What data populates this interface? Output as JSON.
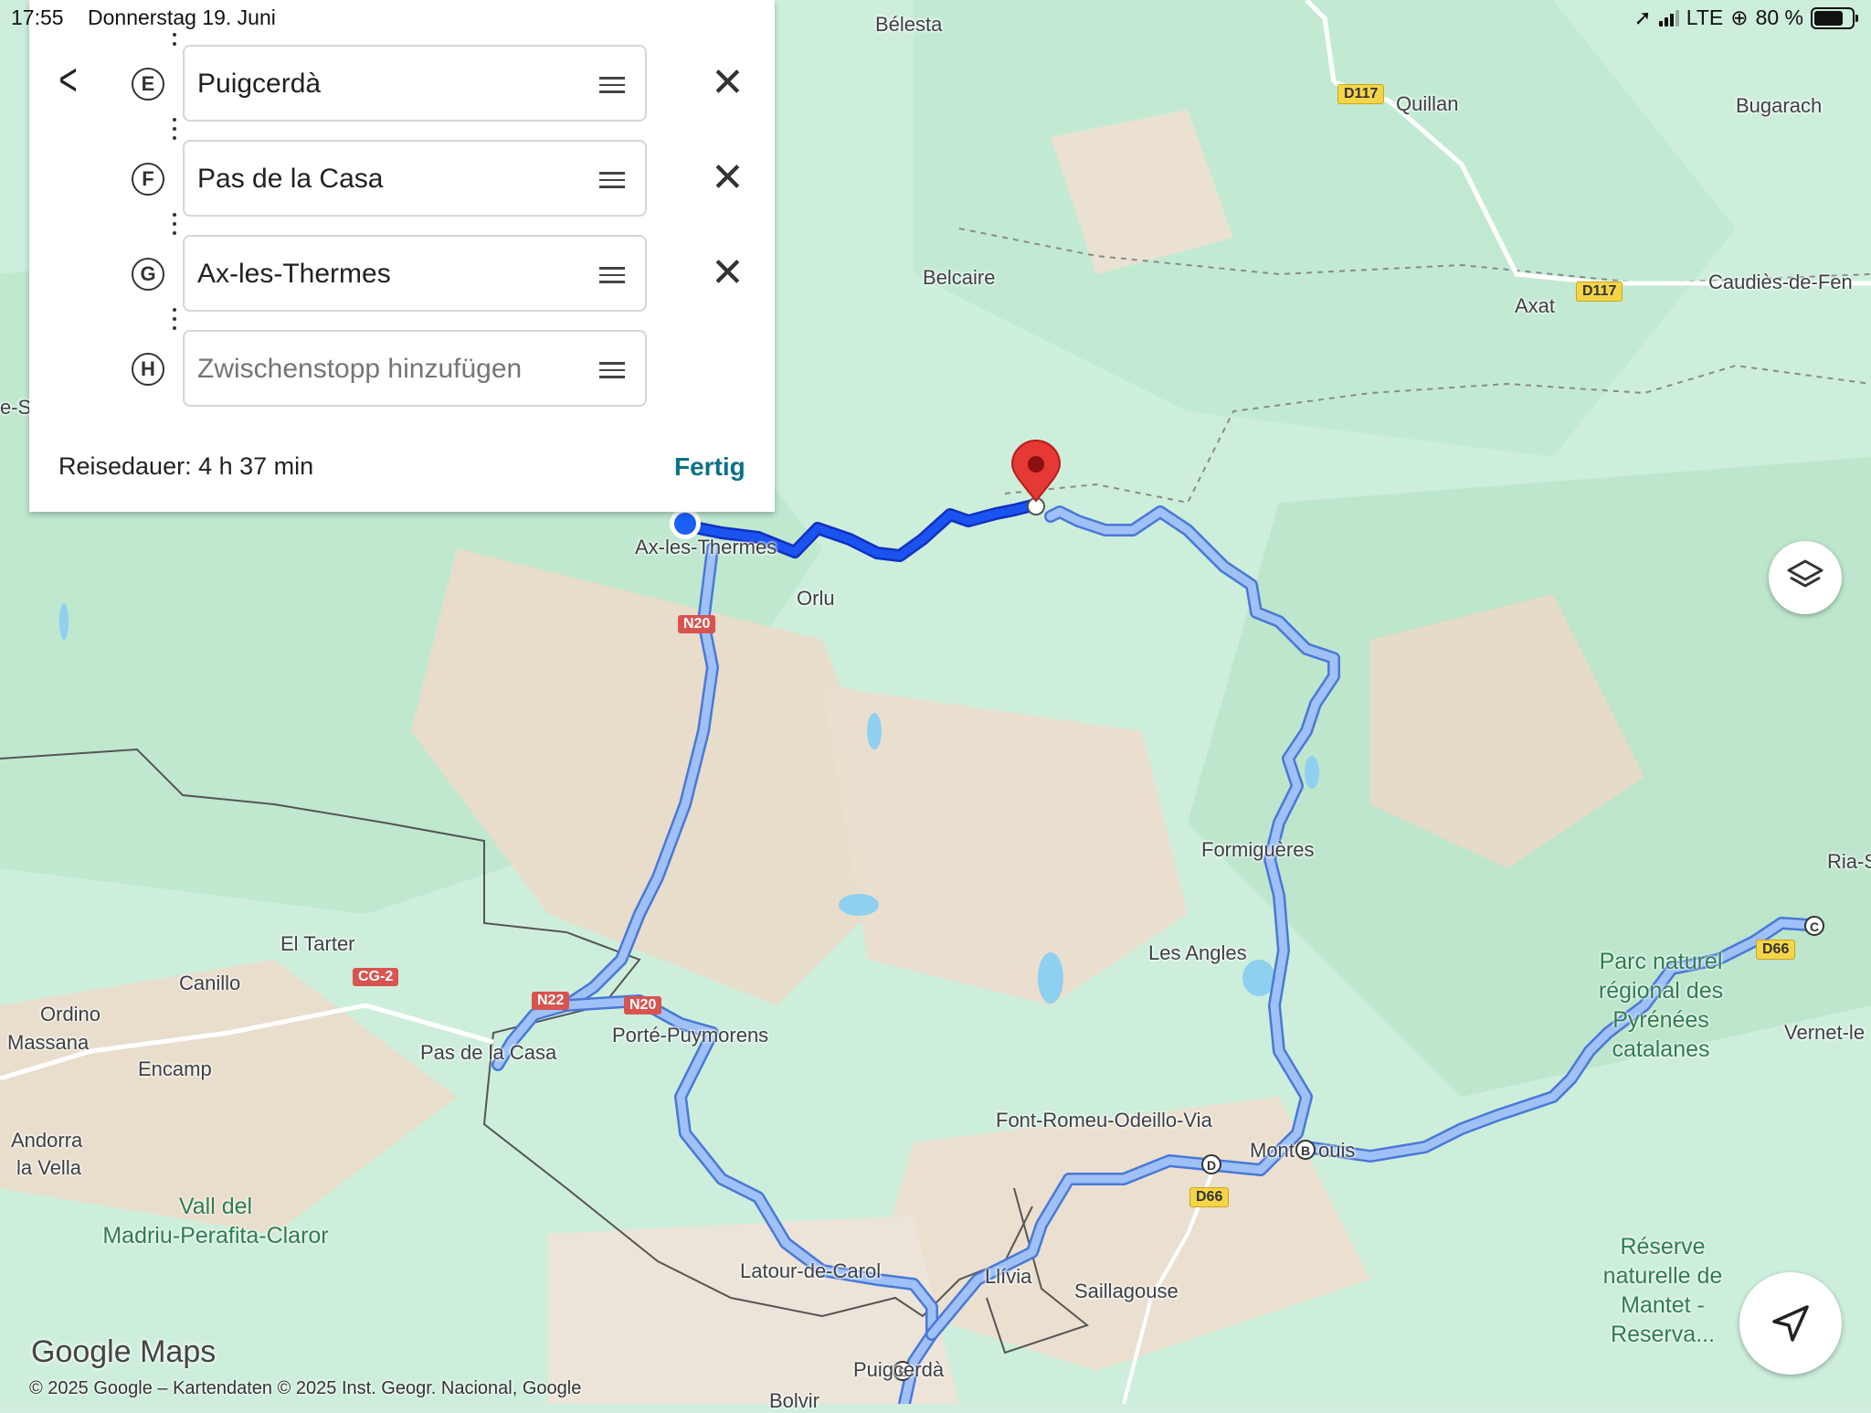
{
  "status_bar": {
    "time": "17:55",
    "date": "Donnerstag 19. Juni",
    "network": "LTE",
    "battery": "80 %",
    "battery_level": 0.8
  },
  "route_panel": {
    "stops": [
      {
        "letter": "E",
        "value": "Puigcerdà"
      },
      {
        "letter": "F",
        "value": "Pas de la Casa"
      },
      {
        "letter": "G",
        "value": "Ax-les-Thermes"
      },
      {
        "letter": "H",
        "placeholder": "Zwischenstopp hinzufügen"
      }
    ],
    "duration": "Reisedauer: 4 h 37 min",
    "done_label": "Fertig"
  },
  "map": {
    "places": [
      "Bélesta",
      "Quillan",
      "Bugarach",
      "Belcaire",
      "Axat",
      "Caudiès-de-Fen",
      "Ax-les-Thermes",
      "Orlu",
      "Formiguères",
      "Les Angles",
      "El Tarter",
      "Canillo",
      "Ordino",
      "Massana",
      "Encamp",
      "Pas de la Casa",
      "Porté-Puymorens",
      "Andorra",
      "la Vella",
      "Font-Romeu-Odeillo-Via",
      "Mont",
      "ouis",
      "Llívia",
      "Saillagouse",
      "Latour-de-Carol",
      "Puigcerdà",
      "Vernet-le",
      "Ria-S",
      "e-S",
      "Bolvir"
    ],
    "parks": [
      "Vall del",
      "Madriu-Perafita-Claror",
      "Parc naturel",
      "régional des",
      "Pyrénées",
      "catalanes",
      "Réserve",
      "naturelle de",
      "Mantet -",
      "Reserva..."
    ],
    "road_shields": [
      "D117",
      "D117",
      "N20",
      "N22",
      "N20",
      "CG-2",
      "D66",
      "D66"
    ],
    "waypoint_markers": [
      "B",
      "C",
      "D",
      "E"
    ],
    "logo": "Google Maps",
    "attribution": "© 2025 Google – Kartendaten © 2025 Inst. Geogr. Nacional, Google"
  },
  "colors": {
    "route": "#1a53f0",
    "route_alt": "#7aa6f5",
    "pin": "#e53935",
    "accent": "#0b7285"
  },
  "icons": [
    "back-arrow-icon",
    "drag-handle-icon",
    "close-icon",
    "layers-icon",
    "navigation-arrow-icon",
    "destination-pin-icon",
    "current-location-icon"
  ]
}
